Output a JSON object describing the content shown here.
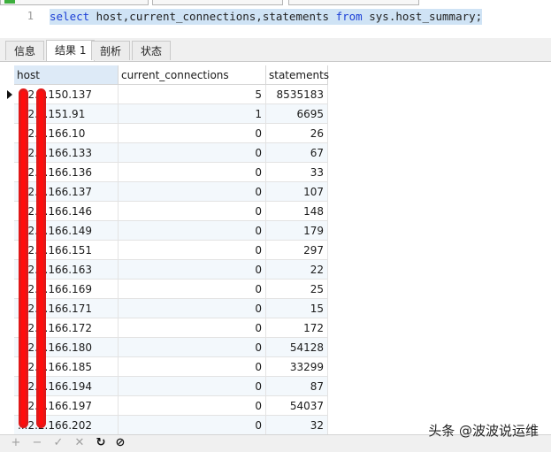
{
  "editor": {
    "line_number": "1",
    "tokens": {
      "select": "select",
      "cols": " host,current_connections,statements ",
      "from": "from",
      "table": " sys.host_summary;"
    }
  },
  "tabs": [
    "信息",
    "结果 1",
    "剖析",
    "状态"
  ],
  "grid": {
    "headers": [
      "host",
      "current_connections",
      "statements"
    ],
    "rows": [
      {
        "host": "...2.2.150.137",
        "cc": "5",
        "st": "8535183"
      },
      {
        "host": "...2.2.151.91",
        "cc": "1",
        "st": "6695"
      },
      {
        "host": "...2.2.166.10",
        "cc": "0",
        "st": "26"
      },
      {
        "host": "...2.2.166.133",
        "cc": "0",
        "st": "67"
      },
      {
        "host": "...2.2.166.136",
        "cc": "0",
        "st": "33"
      },
      {
        "host": "...2.2.166.137",
        "cc": "0",
        "st": "107"
      },
      {
        "host": "...2.2.166.146",
        "cc": "0",
        "st": "148"
      },
      {
        "host": "...2.2.166.149",
        "cc": "0",
        "st": "179"
      },
      {
        "host": "...2.2.166.151",
        "cc": "0",
        "st": "297"
      },
      {
        "host": "...2.2.166.163",
        "cc": "0",
        "st": "22"
      },
      {
        "host": "...2.2.166.169",
        "cc": "0",
        "st": "25"
      },
      {
        "host": "...2.2.166.171",
        "cc": "0",
        "st": "15"
      },
      {
        "host": "...2.2.166.172",
        "cc": "0",
        "st": "172"
      },
      {
        "host": "...2.2.166.180",
        "cc": "0",
        "st": "54128"
      },
      {
        "host": "...2.2.166.185",
        "cc": "0",
        "st": "33299"
      },
      {
        "host": "...2.2.166.194",
        "cc": "0",
        "st": "87"
      },
      {
        "host": "...2.2.166.197",
        "cc": "0",
        "st": "54037"
      },
      {
        "host": "...2.2.166.202",
        "cc": "0",
        "st": "32"
      }
    ]
  },
  "toolbar": {
    "add": "+",
    "remove": "−",
    "apply": "✓",
    "discard": "✕",
    "refresh": "↻",
    "stop": "⊘"
  },
  "watermark": "头条 @波波说运维"
}
